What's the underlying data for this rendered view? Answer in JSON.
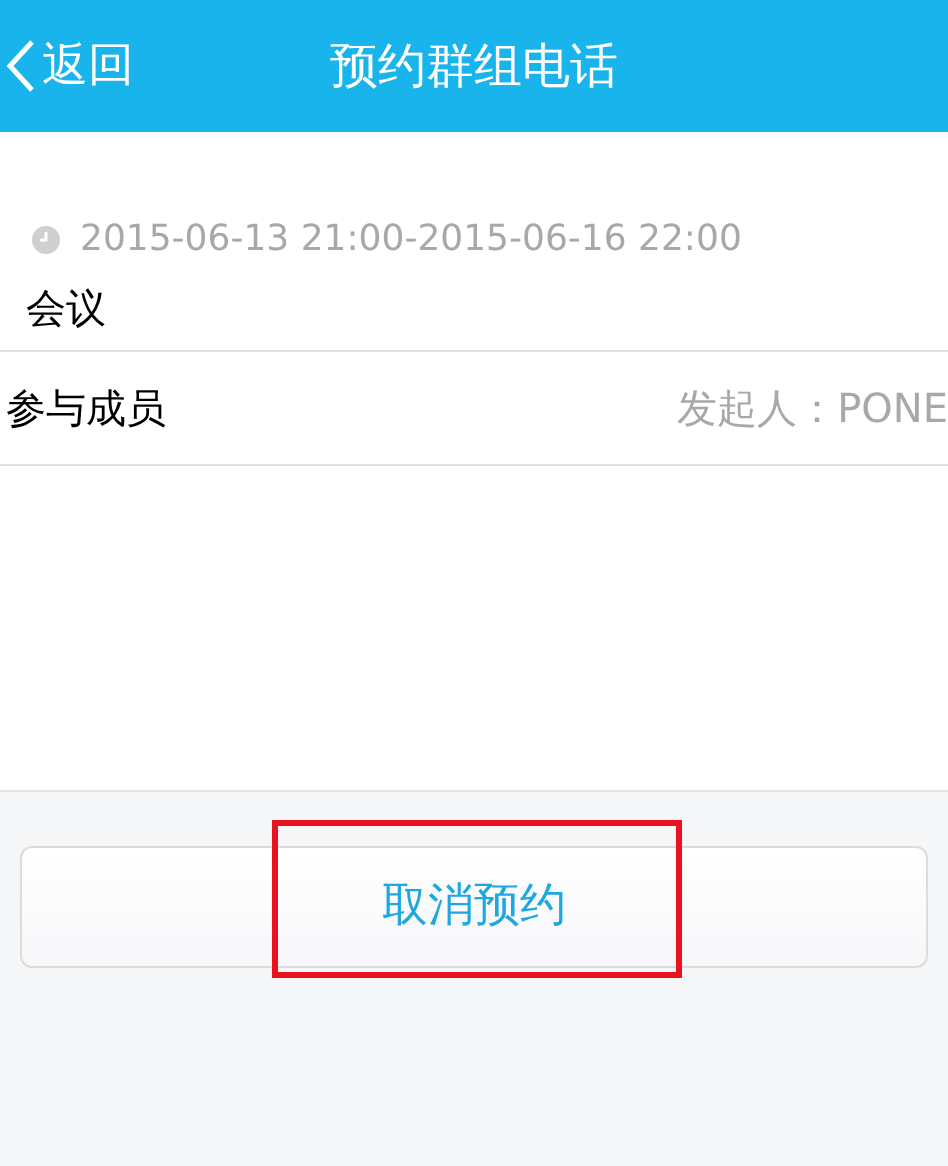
{
  "nav_bar": {
    "back": "返回",
    "title": "预约群组电话"
  },
  "meeting": {
    "time": "2015-06-13 21:00-2015-06-16 22:00",
    "subject": "会议"
  },
  "members": {
    "label": "参与成员",
    "initiator": "发起人：PONE"
  },
  "cancel_button": {
    "label": "取消预约",
    "highlighted": true
  }
}
